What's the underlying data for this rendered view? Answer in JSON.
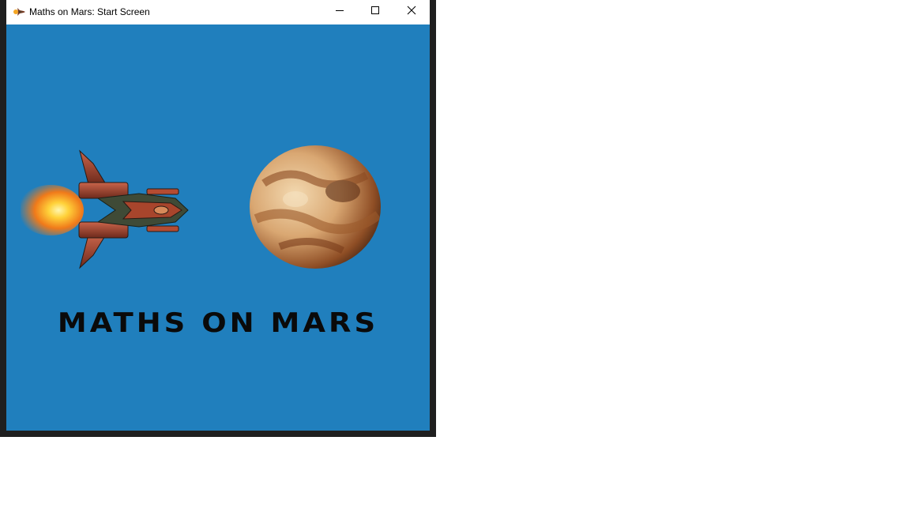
{
  "window": {
    "title": "Maths on Mars: Start Screen",
    "icon": "spaceship-app-icon",
    "controls": [
      "minimize-icon",
      "maximize-icon",
      "close-icon"
    ]
  },
  "game": {
    "title": "MATHS ON MARS",
    "background_color": "#207fbd",
    "sprites": [
      "spaceship",
      "planet"
    ]
  }
}
